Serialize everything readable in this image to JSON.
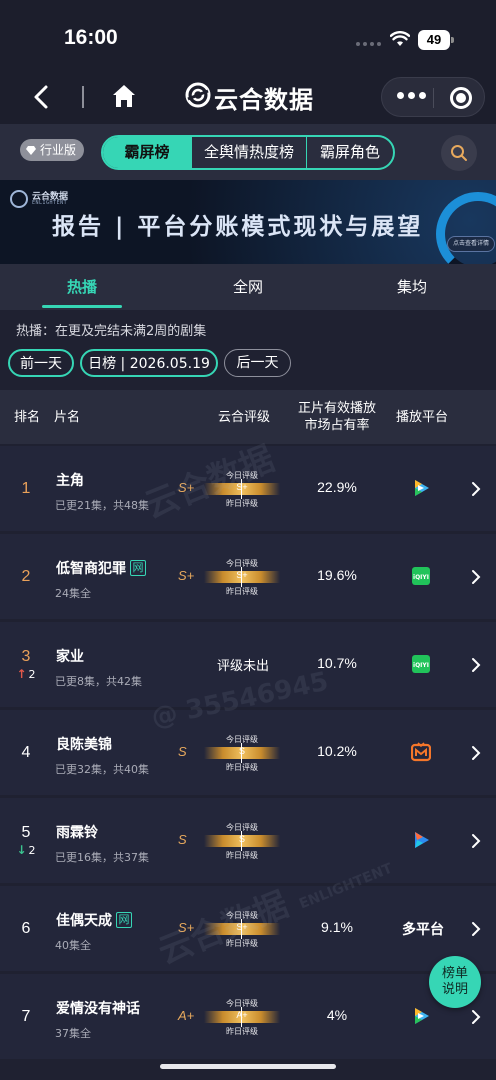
{
  "status_bar": {
    "time": "16:00",
    "battery": "49"
  },
  "nav": {
    "title": "云合数据"
  },
  "filter": {
    "edition": "行业版",
    "segments": [
      "霸屏榜",
      "全舆情热度榜",
      "霸屏角色"
    ],
    "active_segment": "霸屏榜"
  },
  "banner": {
    "brand": "云合数据",
    "brand_en": "ENLIGHTENT",
    "title": "报告 | 平台分账模式现状与展望",
    "button": "点击查看详情"
  },
  "tabs": {
    "items": [
      "热播",
      "全网",
      "集均"
    ],
    "active": "热播"
  },
  "description": "热播：在更及完结未满2周的剧集",
  "date_nav": {
    "prev": "前一天",
    "current": "日榜 | 2026.05.19",
    "next": "后一天"
  },
  "table": {
    "headers": {
      "rank": "排名",
      "name": "片名",
      "rating": "云合评级",
      "share_line1": "正片有效播放",
      "share_line2": "市场占有率",
      "platform": "播放平台"
    },
    "rating_today_label": "今日评级",
    "rating_yesterday_label": "昨日评级",
    "rows": [
      {
        "rank": "1",
        "title": "主角",
        "sub": "已更21集，共48集",
        "grade": "S+",
        "rating_value": "S+",
        "share": "22.9%",
        "platform_icon": "tencent-video-icon"
      },
      {
        "rank": "2",
        "title": "低智商犯罪",
        "net_badge": "网",
        "sub": "24集全",
        "grade": "S+",
        "rating_value": "S+",
        "share": "19.6%",
        "platform_icon": "iqiyi-icon"
      },
      {
        "rank": "3",
        "rank_change": "2",
        "rank_dir": "up",
        "title": "家业",
        "sub": "已更8集，共42集",
        "rating_none": "评级未出",
        "share": "10.7%",
        "platform_icon": "iqiyi-icon"
      },
      {
        "rank": "4",
        "title": "良陈美锦",
        "sub": "已更32集，共40集",
        "grade": "S",
        "rating_value": "S",
        "share": "10.2%",
        "platform_icon": "mango-tv-icon"
      },
      {
        "rank": "5",
        "rank_change": "2",
        "rank_dir": "down",
        "title": "雨霖铃",
        "sub": "已更16集，共37集",
        "grade": "S",
        "rating_value": "S",
        "platform_icon": "youku-icon"
      },
      {
        "rank": "6",
        "title": "佳偶天成",
        "net_badge": "网",
        "sub": "40集全",
        "grade": "S+",
        "rating_value": "S+",
        "share": "9.1%",
        "platform_text": "多平台"
      },
      {
        "rank": "7",
        "title": "爱情没有神话",
        "sub": "37集全",
        "grade": "A+",
        "rating_value": "A+",
        "share": "4%",
        "platform_icon": "tencent-video-icon"
      }
    ]
  },
  "explain_button": {
    "line1": "榜单",
    "line2": "说明"
  },
  "watermark": {
    "brand": "云合数据",
    "brand_en": "ENLIGHTENT",
    "user_id": "@ 35546945"
  },
  "colors": {
    "accent": "#36d6b5",
    "background": "#1f2131",
    "rank_top": "#e9a15a",
    "grade": "#e7a95d",
    "rank_up": "#e2584a",
    "rank_down": "#3bc28f"
  }
}
